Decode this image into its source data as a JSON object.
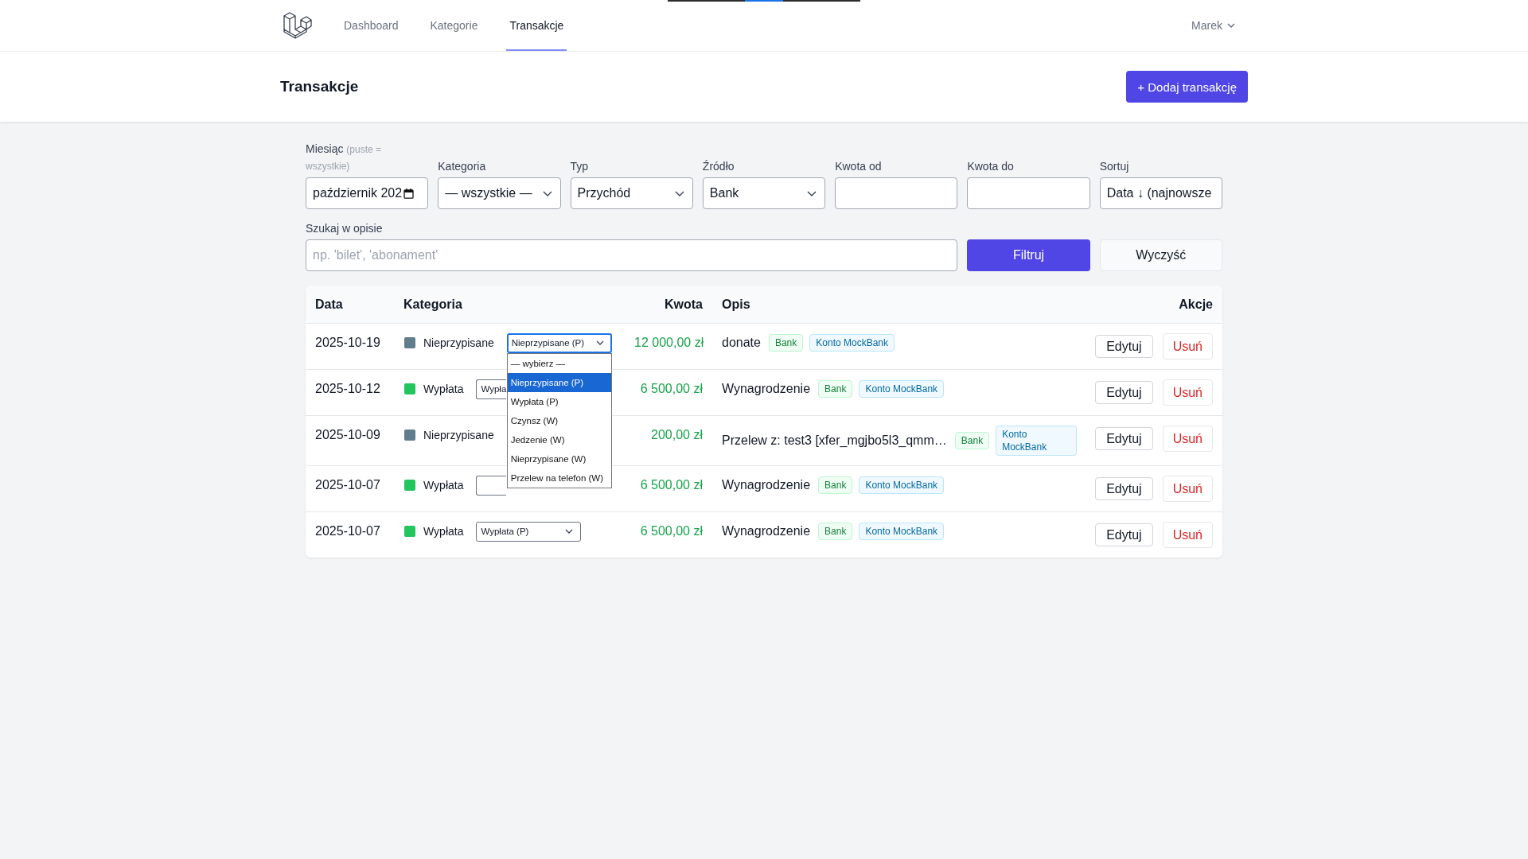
{
  "nav": {
    "links": [
      {
        "label": "Dashboard",
        "selected": false
      },
      {
        "label": "Kategorie",
        "selected": false
      },
      {
        "label": "Transakcje",
        "selected": true
      }
    ],
    "user": "Marek"
  },
  "header": {
    "title": "Transakcje",
    "add_button": "+ Dodaj transakcję"
  },
  "filters": {
    "fields": [
      {
        "kind": "month",
        "label": "Miesiąc",
        "hint": "(puste = wszystkie)",
        "value": "październik 202"
      },
      {
        "kind": "select",
        "label": "Kategoria",
        "value": "— wszystkie —"
      },
      {
        "kind": "select",
        "label": "Typ",
        "value": "Przychód"
      },
      {
        "kind": "select",
        "label": "Źródło",
        "value": "Bank"
      },
      {
        "kind": "text",
        "label": "Kwota od"
      },
      {
        "kind": "text",
        "label": "Kwota do"
      },
      {
        "kind": "sort",
        "label": "Sortuj",
        "value": "Data ↓ (najnowsze"
      }
    ],
    "search": {
      "label": "Szukaj w opisie",
      "placeholder": "np. 'bilet', 'abonament'"
    },
    "buttons": [
      {
        "kind": "primary",
        "label": "Filtruj"
      },
      {
        "kind": "secondary",
        "label": "Wyczyść"
      }
    ]
  },
  "table": {
    "columns": [
      "Data",
      "Kategoria",
      "Kwota",
      "Opis",
      "Akcje"
    ],
    "rows": [
      {
        "date": "2025-10-19",
        "category": {
          "name": "Nieprzypisane",
          "color": "#607d8b"
        },
        "select": {
          "value": "Nieprzypisane (P)",
          "focused": true,
          "open": true,
          "covered": false,
          "options": [
            {
              "label": "— wybierz —",
              "selected": false
            },
            {
              "label": "Nieprzypisane (P)",
              "selected": true
            },
            {
              "label": "Wypłata (P)",
              "selected": false
            },
            {
              "label": "Czynsz (W)",
              "selected": false
            },
            {
              "label": "Jedzenie (W)",
              "selected": false
            },
            {
              "label": "Nieprzypisane (W)",
              "selected": false
            },
            {
              "label": "Przelew na telefon (W)",
              "selected": false
            }
          ]
        },
        "amount": "12 000,00 zł",
        "description": "donate",
        "tags": [
          {
            "kind": "source",
            "label": "Bank"
          },
          {
            "kind": "account",
            "label": "Konto MockBank"
          }
        ],
        "actions": [
          {
            "kind": "edit",
            "label": "Edytuj"
          },
          {
            "kind": "delete",
            "label": "Usuń"
          }
        ]
      },
      {
        "date": "2025-10-12",
        "category": {
          "name": "Wypłata",
          "color": "#22c55e"
        },
        "select": {
          "value": "Wypła",
          "focused": false,
          "open": false,
          "covered": true
        },
        "amount": "6 500,00 zł",
        "description": "Wynagrodzenie",
        "tags": [
          {
            "kind": "source",
            "label": "Bank"
          },
          {
            "kind": "account",
            "label": "Konto MockBank"
          }
        ],
        "actions": [
          {
            "kind": "edit",
            "label": "Edytuj"
          },
          {
            "kind": "delete",
            "label": "Usuń"
          }
        ]
      },
      {
        "date": "2025-10-09",
        "category": {
          "name": "Nieprzypisane",
          "color": "#607d8b"
        },
        "amount": "200,00 zł",
        "description": "Przelew z: test3 [xfer_mgjbo5l3_qmm…",
        "tags": [
          {
            "kind": "source",
            "label": "Bank"
          },
          {
            "kind": "account",
            "label": "Konto MockBank"
          }
        ],
        "actions": [
          {
            "kind": "edit",
            "label": "Edytuj"
          },
          {
            "kind": "delete",
            "label": "Usuń"
          }
        ]
      },
      {
        "date": "2025-10-07",
        "category": {
          "name": "Wypłata",
          "color": "#22c55e"
        },
        "select": {
          "focused": false,
          "open": false,
          "covered": true
        },
        "amount": "6 500,00 zł",
        "description": "Wynagrodzenie",
        "tags": [
          {
            "kind": "source",
            "label": "Bank"
          },
          {
            "kind": "account",
            "label": "Konto MockBank"
          }
        ],
        "actions": [
          {
            "kind": "edit",
            "label": "Edytuj"
          },
          {
            "kind": "delete",
            "label": "Usuń"
          }
        ]
      },
      {
        "date": "2025-10-07",
        "category": {
          "name": "Wypłata",
          "color": "#22c55e"
        },
        "select": {
          "value": "Wypłata (P)",
          "focused": false,
          "open": false,
          "covered": false
        },
        "amount": "6 500,00 zł",
        "description": "Wynagrodzenie",
        "tags": [
          {
            "kind": "source",
            "label": "Bank"
          },
          {
            "kind": "account",
            "label": "Konto MockBank"
          }
        ],
        "actions": [
          {
            "kind": "edit",
            "label": "Edytuj"
          },
          {
            "kind": "delete",
            "label": "Usuń"
          }
        ]
      }
    ]
  }
}
